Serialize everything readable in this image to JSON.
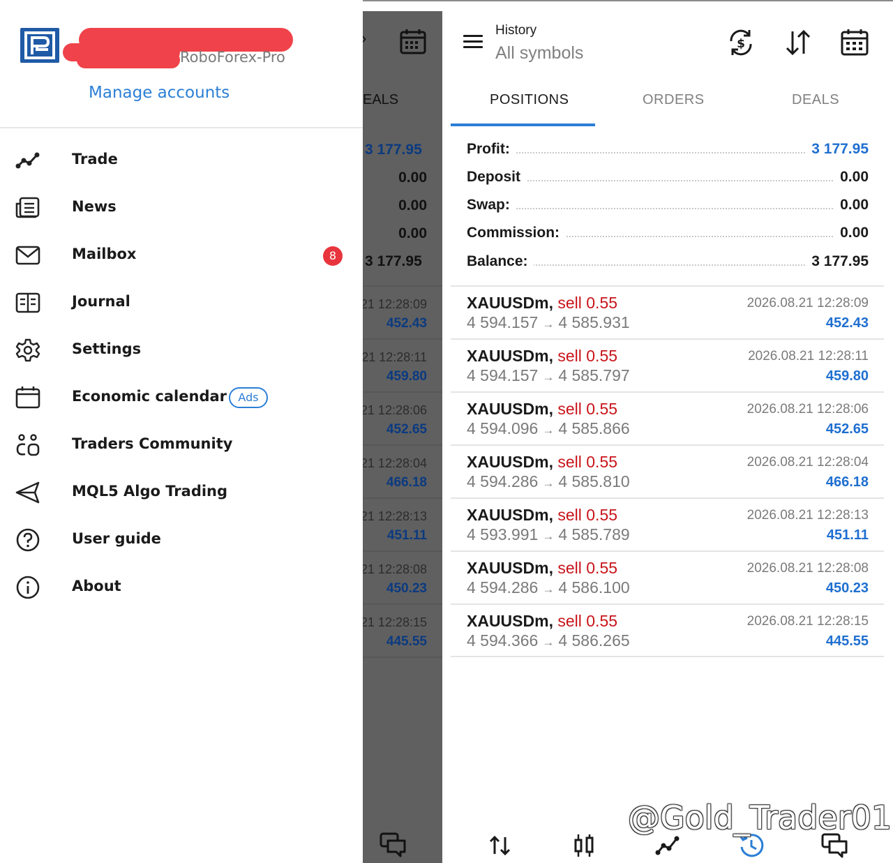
{
  "drawer": {
    "server": "RoboForex-Pro",
    "manage_accounts": "Manage accounts",
    "items": [
      {
        "label": "Trade",
        "icon": "trade-icon"
      },
      {
        "label": "News",
        "icon": "news-icon"
      },
      {
        "label": "Mailbox",
        "icon": "mailbox-icon",
        "badge": "8"
      },
      {
        "label": "Journal",
        "icon": "journal-icon"
      },
      {
        "label": "Settings",
        "icon": "settings-icon"
      },
      {
        "label": "Economic calendar",
        "icon": "calendar-icon",
        "tag": "Ads"
      },
      {
        "label": "Traders Community",
        "icon": "community-icon"
      },
      {
        "label": "MQL5 Algo Trading",
        "icon": "algo-trading-icon"
      },
      {
        "label": "User guide",
        "icon": "help-icon"
      },
      {
        "label": "About",
        "icon": "info-icon"
      }
    ]
  },
  "dimmed": {
    "tab_fragment": "EALS",
    "summary": [
      "3 177.95",
      "0.00",
      "0.00",
      "0.00",
      "3 177.95"
    ],
    "rows": [
      {
        "time": ".21 12:28:09",
        "profit": "452.43"
      },
      {
        "time": ".21 12:28:11",
        "profit": "459.80"
      },
      {
        "time": ".21 12:28:06",
        "profit": "452.65"
      },
      {
        "time": ".21 12:28:04",
        "profit": "466.18"
      },
      {
        "time": ".21 12:28:13",
        "profit": "451.11"
      },
      {
        "time": ".21 12:28:08",
        "profit": "450.23"
      },
      {
        "time": ".21 12:28:15",
        "profit": "445.55"
      }
    ]
  },
  "header": {
    "title": "History",
    "subtitle": "All symbols"
  },
  "tabs": [
    {
      "label": "POSITIONS",
      "active": true
    },
    {
      "label": "ORDERS",
      "active": false
    },
    {
      "label": "DEALS",
      "active": false
    }
  ],
  "summary": [
    {
      "label": "Profit:",
      "value": "3 177.95",
      "color": "#1f6fd0"
    },
    {
      "label": "Deposit",
      "value": "0.00",
      "color": "#1a1a1a"
    },
    {
      "label": "Swap:",
      "value": "0.00",
      "color": "#1a1a1a"
    },
    {
      "label": "Commission:",
      "value": "0.00",
      "color": "#1a1a1a"
    },
    {
      "label": "Balance:",
      "value": "3 177.95",
      "color": "#1a1a1a"
    }
  ],
  "deals": [
    {
      "symbol": "XAUUSDm,",
      "side": "sell 0.55",
      "open": "4 594.157",
      "arrow": "→",
      "close": "4 585.931",
      "time": "2026.08.21 12:28:09",
      "profit": "452.43"
    },
    {
      "symbol": "XAUUSDm,",
      "side": "sell 0.55",
      "open": "4 594.157",
      "arrow": "→",
      "close": "4 585.797",
      "time": "2026.08.21 12:28:11",
      "profit": "459.80"
    },
    {
      "symbol": "XAUUSDm,",
      "side": "sell 0.55",
      "open": "4 594.096",
      "arrow": "→",
      "close": "4 585.866",
      "time": "2026.08.21 12:28:06",
      "profit": "452.65"
    },
    {
      "symbol": "XAUUSDm,",
      "side": "sell 0.55",
      "open": "4 594.286",
      "arrow": "→",
      "close": "4 585.810",
      "time": "2026.08.21 12:28:04",
      "profit": "466.18"
    },
    {
      "symbol": "XAUUSDm,",
      "side": "sell 0.55",
      "open": "4 593.991",
      "arrow": "→",
      "close": "4 585.789",
      "time": "2026.08.21 12:28:13",
      "profit": "451.11"
    },
    {
      "symbol": "XAUUSDm,",
      "side": "sell 0.55",
      "open": "4 594.286",
      "arrow": "→",
      "close": "4 586.100",
      "time": "2026.08.21 12:28:08",
      "profit": "450.23"
    },
    {
      "symbol": "XAUUSDm,",
      "side": "sell 0.55",
      "open": "4 594.366",
      "arrow": "→",
      "close": "4 586.265",
      "time": "2026.08.21 12:28:15",
      "profit": "445.55"
    }
  ],
  "bottom_nav": [
    "quotes-icon",
    "chart-icon",
    "trade-icon",
    "history-icon",
    "chat-icon"
  ],
  "watermark": "@Gold_Trader01",
  "colors": {
    "accent": "#2b7fd6",
    "sell": "#c8141a",
    "profit": "#1f6fd0",
    "badge": "#e8343d"
  }
}
